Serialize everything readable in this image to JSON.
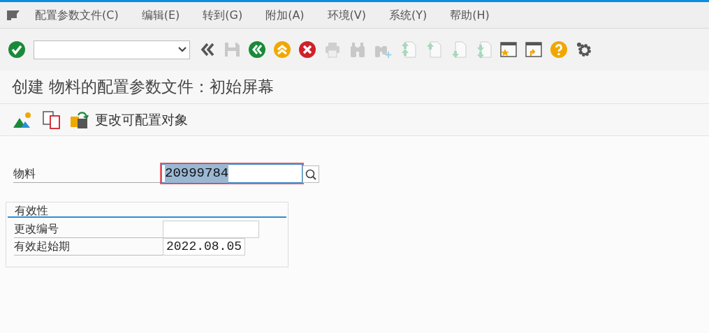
{
  "menu": [
    "配置参数文件(C)",
    "编辑(E)",
    "转到(G)",
    "附加(A)",
    "环境(V)",
    "系统(Y)",
    "帮助(H)"
  ],
  "toolbar": [
    {
      "kind": "enter",
      "disabled": false
    },
    {
      "kind": "command-field"
    },
    {
      "kind": "collapse",
      "disabled": false
    },
    {
      "kind": "save",
      "disabled": true
    },
    {
      "kind": "back",
      "disabled": false
    },
    {
      "kind": "exit",
      "disabled": false
    },
    {
      "kind": "cancel",
      "disabled": false
    },
    {
      "kind": "print",
      "disabled": true
    },
    {
      "kind": "find",
      "disabled": true
    },
    {
      "kind": "find-next",
      "disabled": true
    },
    {
      "kind": "first-page",
      "disabled": true
    },
    {
      "kind": "prev-page",
      "disabled": true
    },
    {
      "kind": "next-page",
      "disabled": true
    },
    {
      "kind": "last-page",
      "disabled": true
    },
    {
      "kind": "new-session",
      "disabled": false
    },
    {
      "kind": "shortcut",
      "disabled": false
    },
    {
      "kind": "help",
      "disabled": false
    },
    {
      "kind": "settings",
      "disabled": false
    }
  ],
  "title": "创建 物料的配置参数文件：初始屏幕",
  "app_toolbar": [
    {
      "kind": "classify"
    },
    {
      "kind": "copy"
    },
    {
      "kind": "change-object",
      "label": "更改可配置对象"
    }
  ],
  "material": {
    "label": "物料",
    "value": "20999784",
    "selected": true
  },
  "validity": {
    "title": "有效性",
    "fields": [
      {
        "label": "更改编号"
      },
      {
        "label": "有效起始期",
        "value": "2022.08.05"
      }
    ]
  }
}
